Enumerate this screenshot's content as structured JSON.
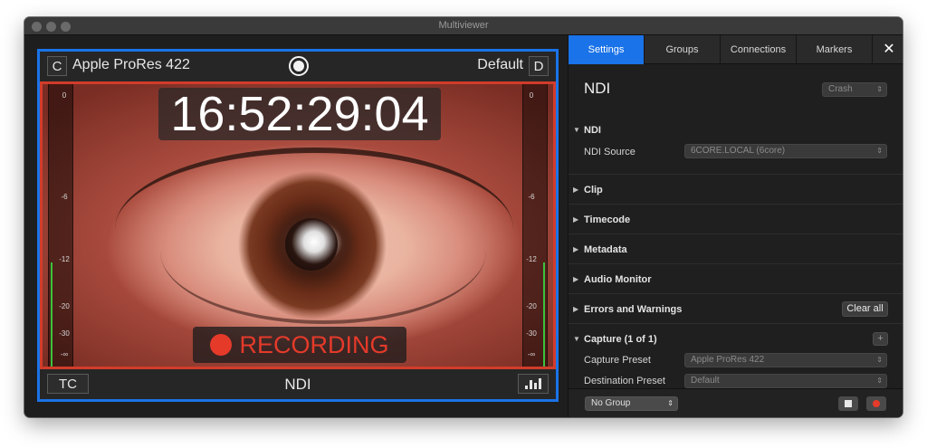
{
  "window": {
    "title": "Multiviewer"
  },
  "viewer": {
    "left_button": "C",
    "codec": "Apple ProRes 422",
    "preset": "Default",
    "right_button": "D",
    "timecode": "16:52:29:04",
    "recording_label": "RECORDING",
    "tc_button": "TC",
    "source_name": "NDI",
    "meter_ticks": [
      "0",
      "-6",
      "-12",
      "-20",
      "-30",
      "-∞"
    ],
    "colors": {
      "selection": "#1a73e8",
      "recording": "#e53a2a",
      "meter": "#3cc23c"
    }
  },
  "panel": {
    "tabs": [
      "Settings",
      "Groups",
      "Connections",
      "Markers"
    ],
    "active_tab": "Settings",
    "title": "NDI",
    "crash_popup": "Crash",
    "ndi_section": {
      "label": "NDI",
      "source_label": "NDI Source",
      "source_value": "6CORE.LOCAL (6core)"
    },
    "sections": [
      "Clip",
      "Timecode",
      "Metadata",
      "Audio Monitor",
      "Errors and Warnings"
    ],
    "clear_all": "Clear all",
    "capture": {
      "label": "Capture (1 of 1)",
      "add_button": "+",
      "preset_label": "Capture Preset",
      "preset_value": "Apple ProRes 422",
      "dest_label": "Destination Preset",
      "dest_value": "Default"
    },
    "footer": {
      "group_select": "No Group"
    }
  }
}
